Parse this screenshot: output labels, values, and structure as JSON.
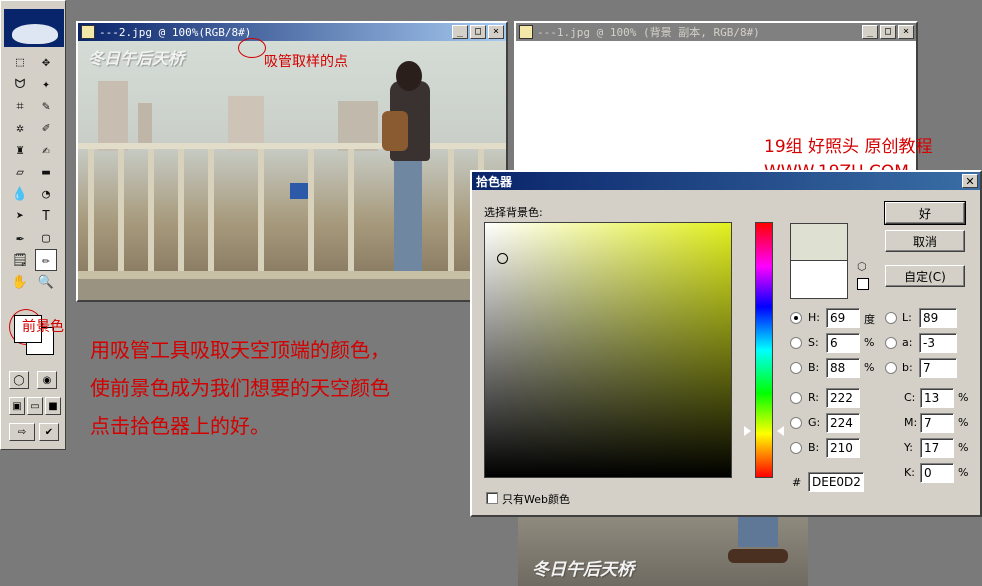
{
  "toolbox": {
    "tools": [
      {
        "name": "marquee-tool",
        "glyph": "⬚"
      },
      {
        "name": "move-tool",
        "glyph": "✥"
      },
      {
        "name": "lasso-tool",
        "glyph": "ᗢ"
      },
      {
        "name": "magic-wand-tool",
        "glyph": "✦"
      },
      {
        "name": "crop-tool",
        "glyph": "⌗"
      },
      {
        "name": "slice-tool",
        "glyph": "✎"
      },
      {
        "name": "healing-tool",
        "glyph": "✲"
      },
      {
        "name": "brush-tool",
        "glyph": "✐"
      },
      {
        "name": "stamp-tool",
        "glyph": "♜"
      },
      {
        "name": "history-brush-tool",
        "glyph": "✍"
      },
      {
        "name": "eraser-tool",
        "glyph": "▱"
      },
      {
        "name": "gradient-tool",
        "glyph": "▬"
      },
      {
        "name": "blur-tool",
        "glyph": "💧"
      },
      {
        "name": "dodge-tool",
        "glyph": "◔"
      },
      {
        "name": "path-select-tool",
        "glyph": "➤"
      },
      {
        "name": "type-tool",
        "glyph": "T"
      },
      {
        "name": "pen-tool",
        "glyph": "✒"
      },
      {
        "name": "shape-tool",
        "glyph": "▢"
      },
      {
        "name": "notes-tool",
        "glyph": "🗒"
      },
      {
        "name": "eyedropper-tool",
        "glyph": "✏"
      },
      {
        "name": "hand-tool",
        "glyph": "✋"
      },
      {
        "name": "zoom-tool",
        "glyph": "🔍"
      }
    ]
  },
  "window1": {
    "title": "---2.jpg @ 100%(RGB/8#)",
    "watermark": "冬日午后天桥"
  },
  "window2": {
    "title": "---1.jpg @ 100% (背景 副本, RGB/8#)"
  },
  "annotations": {
    "eyedropper_point": "吸管取样的点",
    "foreground_label": "前景色",
    "credit_line1": "19组    好照头  原创教程",
    "credit_line2": "WWW.19ZU.COM",
    "instruction_line1": "用吸管工具吸取天空顶端的颜色，",
    "instruction_line2": "使前景色成为我们想要的天空颜色",
    "instruction_line3": "点击拾色器上的好。"
  },
  "color_picker": {
    "title": "拾色器",
    "close_glyph": "✕",
    "subtitle": "选择背景色:",
    "buttons": {
      "ok": "好",
      "cancel": "取消",
      "custom": "自定(C)"
    },
    "new_color": "#dee0d2",
    "old_color": "#ffffff",
    "hsb": {
      "h_label": "H:",
      "h_value": "69",
      "h_unit": "度",
      "s_label": "S:",
      "s_value": "6",
      "s_unit": "%",
      "b_label": "B:",
      "b_value": "88",
      "b_unit": "%"
    },
    "lab": {
      "l_label": "L:",
      "l_value": "89",
      "a_label": "a:",
      "a_value": "-3",
      "b_label": "b:",
      "b_value": "7"
    },
    "rgb": {
      "r_label": "R:",
      "r_value": "222",
      "g_label": "G:",
      "g_value": "224",
      "b_label": "B:",
      "b_value": "210"
    },
    "cmyk": {
      "c_label": "C:",
      "c_value": "13",
      "m_label": "M:",
      "m_value": "7",
      "y_label": "Y:",
      "y_value": "17",
      "k_label": "K:",
      "k_value": "0",
      "unit": "%"
    },
    "hex_label": "#",
    "hex_value": "DEE0D2",
    "web_only_label": "只有Web颜色",
    "hue_color": "#e2f01e"
  },
  "bottom_photo": {
    "watermark": "冬日午后天桥"
  }
}
